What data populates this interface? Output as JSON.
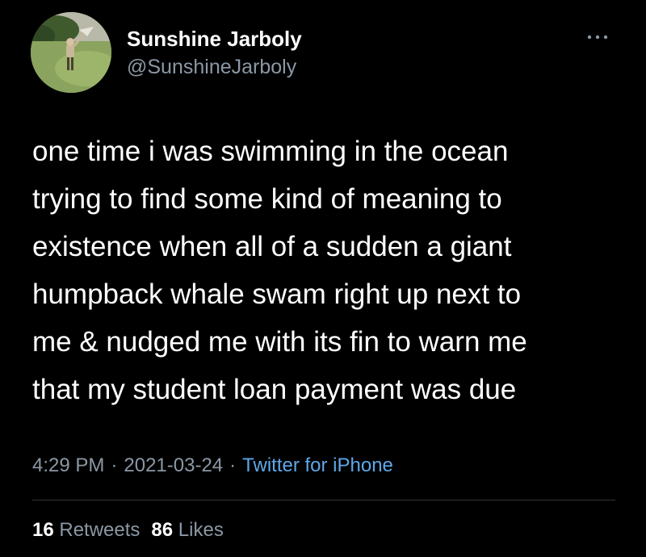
{
  "user": {
    "display_name": "Sunshine Jarboly",
    "handle": "@SunshineJarboly",
    "avatar_icon": "profile-photo-person-on-lawn"
  },
  "more_icon": "more-horizontal-icon",
  "tweet": {
    "lines": [
      "one time i was swimming in the ocean",
      "trying to find some kind of meaning to",
      "existence when all of a sudden a giant",
      "humpback whale swam right up next to",
      "me & nudged me with its fin to warn me",
      "that my student loan payment was due"
    ]
  },
  "meta": {
    "time": "4:29 PM",
    "date": "2021-03-24",
    "separator": "·",
    "source": "Twitter for iPhone"
  },
  "stats": {
    "retweets_count": "16",
    "retweets_label": "Retweets",
    "likes_count": "86",
    "likes_label": "Likes"
  },
  "colors": {
    "background": "#000000",
    "primary_text": "#ffffff",
    "secondary_text": "#8b98a5",
    "link": "#5fa7e8",
    "divider": "#2f3336"
  }
}
